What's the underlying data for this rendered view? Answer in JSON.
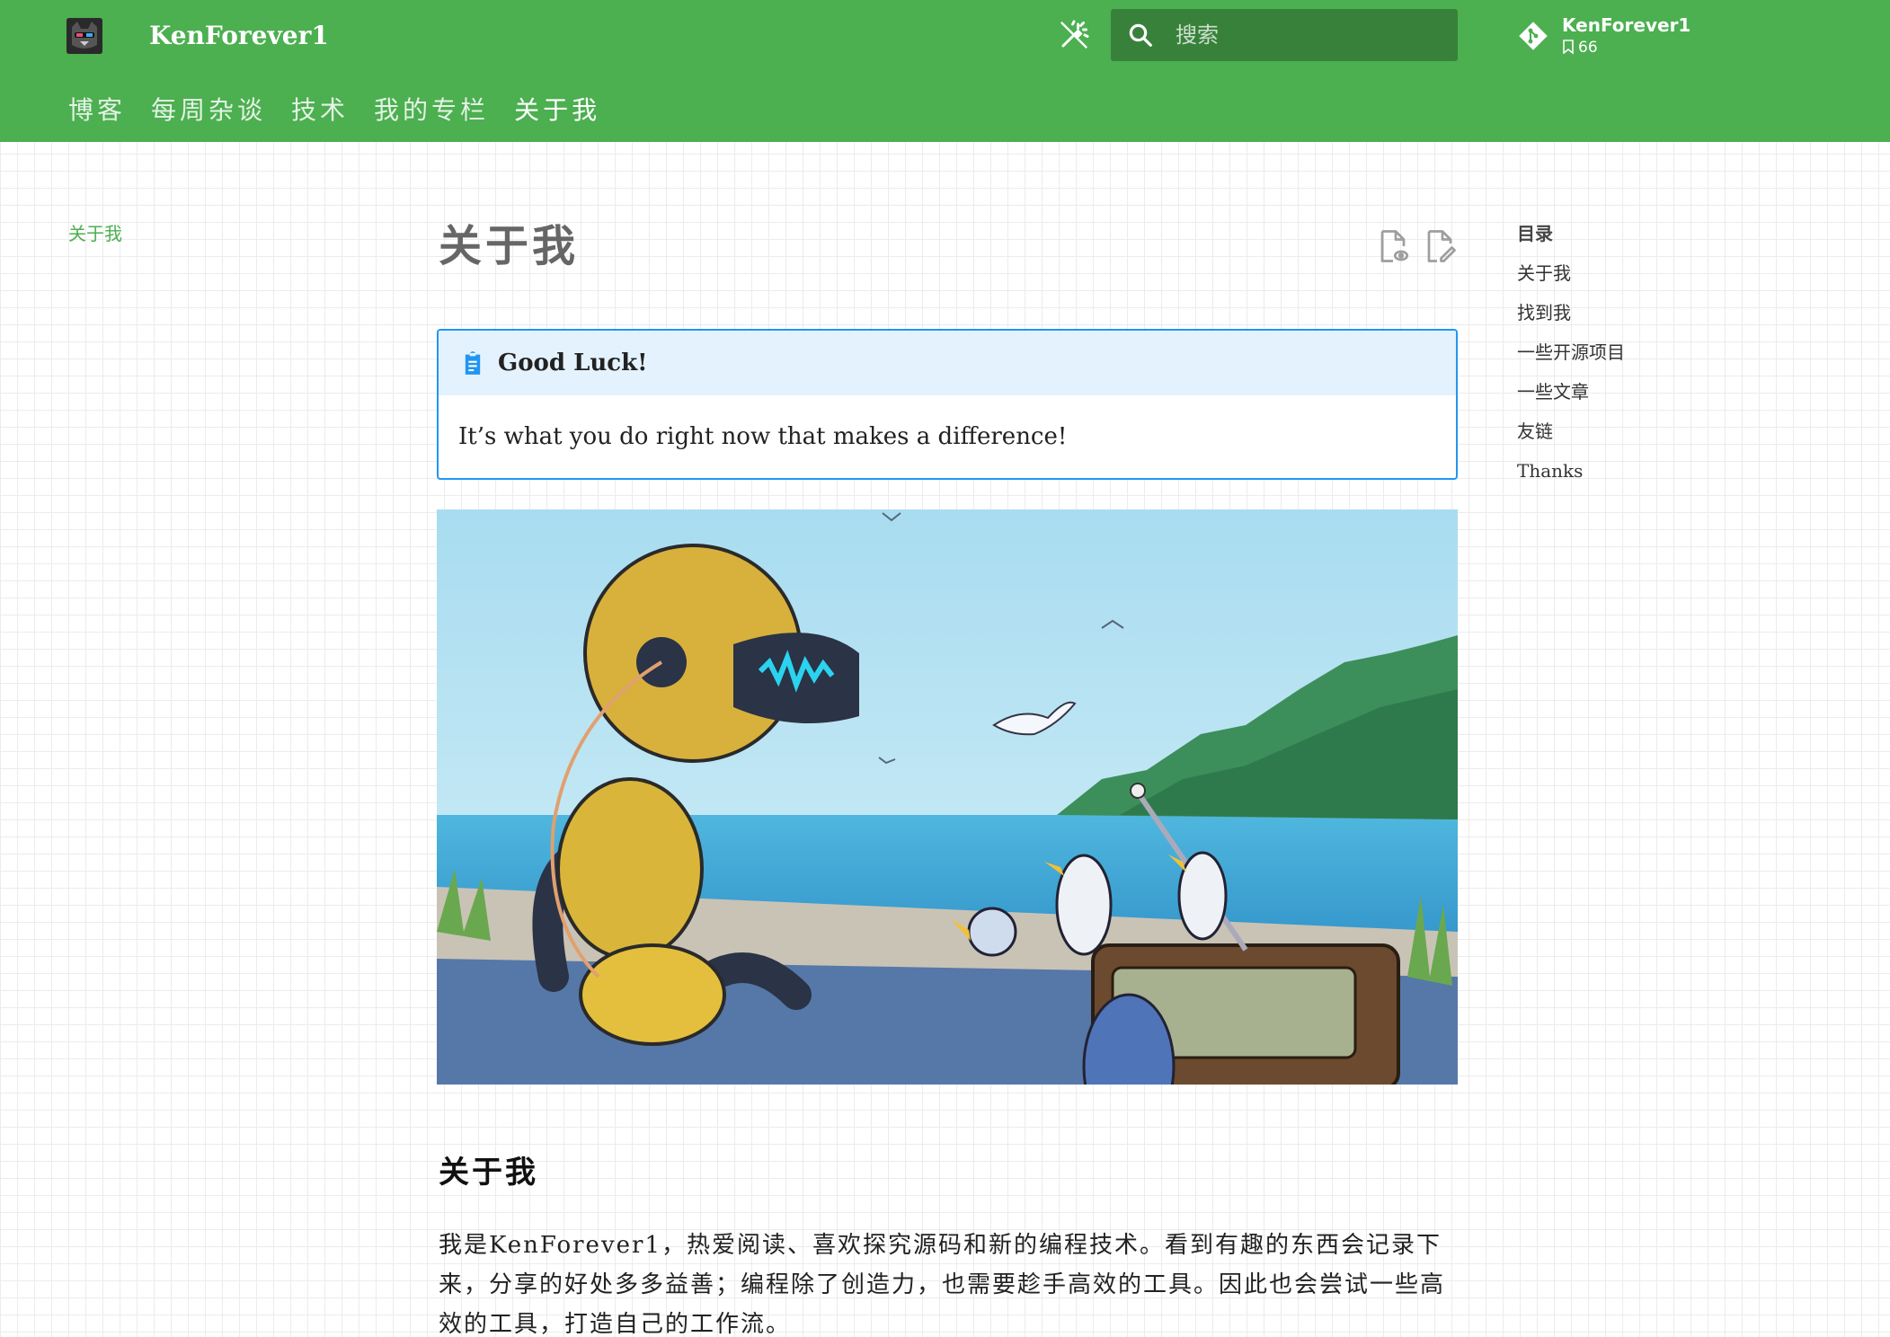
{
  "header": {
    "site_name": "KenForever1",
    "search_placeholder": "搜索",
    "repo": {
      "name": "KenForever1",
      "stars": "66"
    },
    "tabs": [
      {
        "label": "博客"
      },
      {
        "label": "每周杂谈"
      },
      {
        "label": "技术"
      },
      {
        "label": "我的专栏"
      },
      {
        "label": "关于我",
        "active": true
      }
    ]
  },
  "left_nav": {
    "items": [
      {
        "label": "关于我"
      }
    ]
  },
  "toc": {
    "title": "目录",
    "items": [
      {
        "label": "关于我"
      },
      {
        "label": "找到我"
      },
      {
        "label": "一些开源项目"
      },
      {
        "label": "一些文章"
      },
      {
        "label": "友链"
      },
      {
        "label": "Thanks"
      }
    ]
  },
  "main": {
    "title": "关于我",
    "admonition": {
      "title": "Good Luck!",
      "body": "It’s what you do right now that makes a difference!"
    },
    "section_heading": "关于我",
    "paragraph": "我是KenForever1，热爱阅读、喜欢探究源码和新的编程技术。看到有趣的东西会记录下来，分享的好处多多益善；编程除了创造力，也需要趁手高效的工具。因此也会尝试一些高效的工具，打造自己的工作流。"
  },
  "colors": {
    "primary": "#4caf50",
    "admonition_border": "#2196f3",
    "admonition_bg": "#e3f2fd"
  }
}
